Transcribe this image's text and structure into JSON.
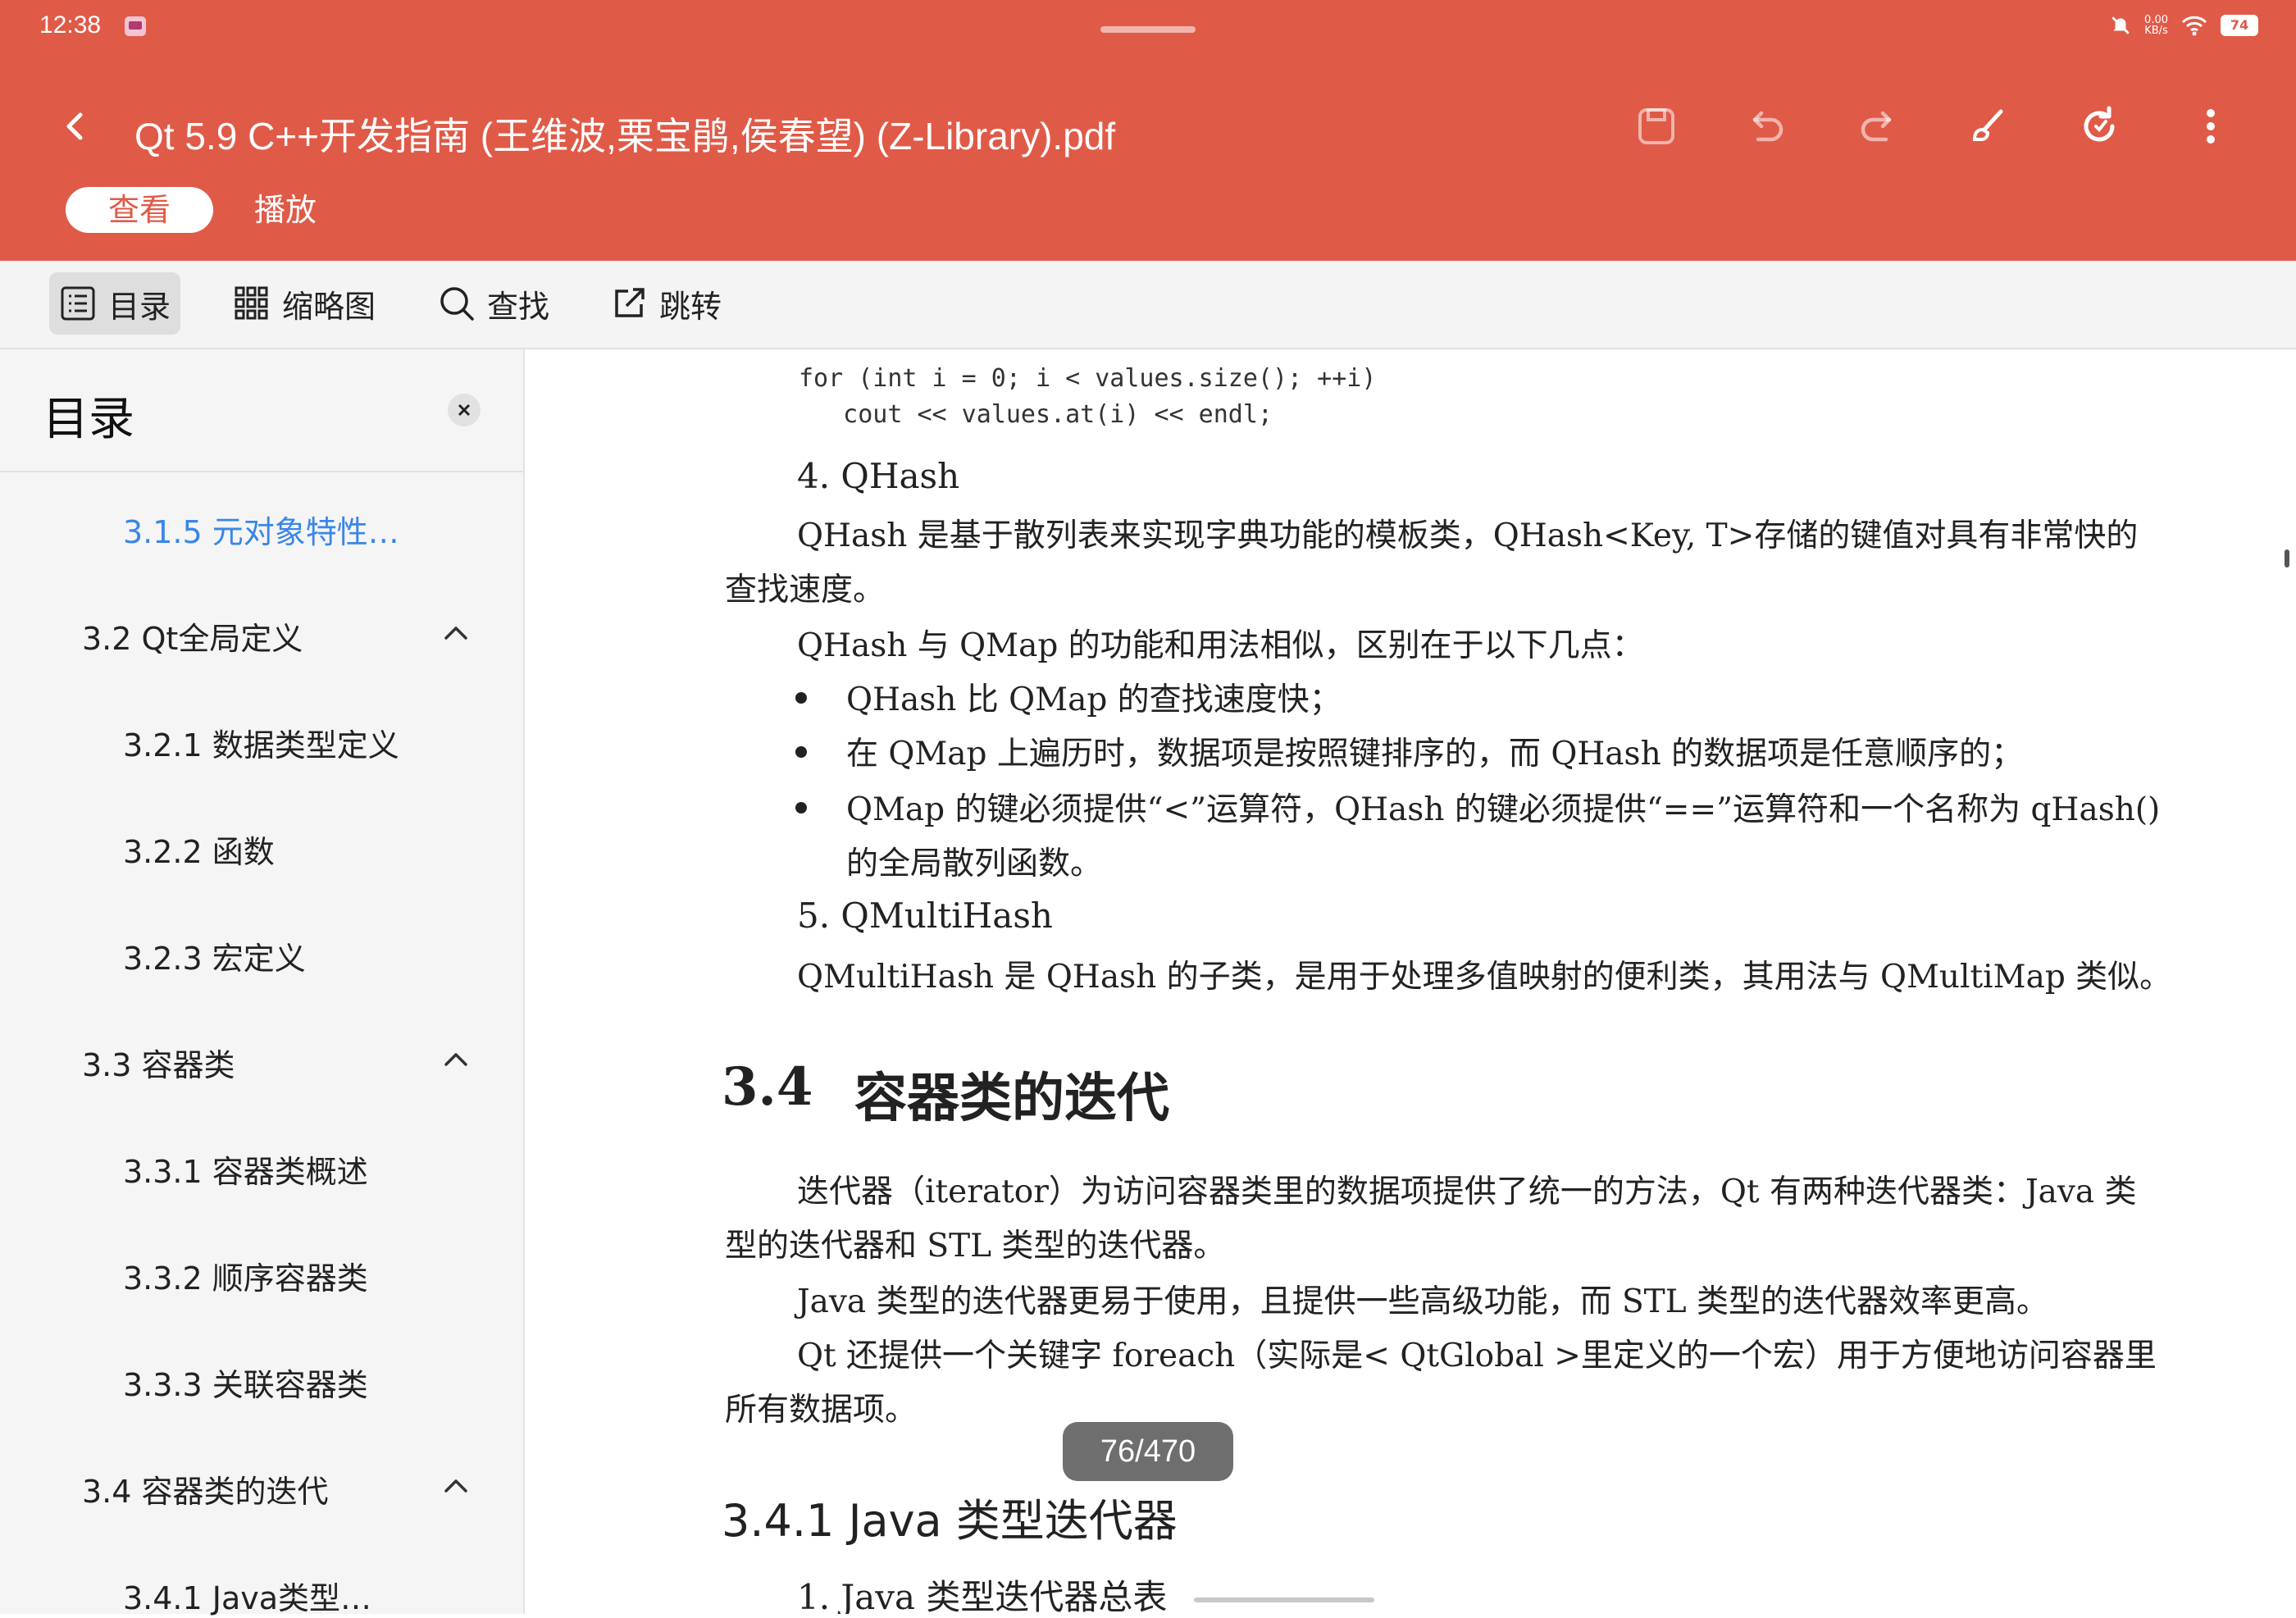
{
  "status_bar": {
    "time": "12:38",
    "net_speed_top": "0.00",
    "net_speed_bottom": "KB/s",
    "battery": "74"
  },
  "header": {
    "title": "Qt 5.9 C++开发指南 (王维波,栗宝鹃,侯春望) (Z-Library).pdf",
    "tabs": [
      {
        "label": "查看",
        "active": true
      },
      {
        "label": "播放",
        "active": false
      }
    ],
    "icons": [
      "back-icon",
      "save-icon",
      "undo-icon",
      "redo-icon",
      "brush-icon",
      "refresh-icon",
      "more-icon"
    ]
  },
  "toolbar": {
    "toc_label": "目录",
    "thumbnails_label": "缩略图",
    "search_label": "查找",
    "jump_label": "跳转"
  },
  "sidebar": {
    "title": "目录",
    "items": [
      {
        "label": "3.1.5 元对象特性…",
        "level": 2,
        "current": true
      },
      {
        "label": "3.2 Qt全局定义",
        "level": 1,
        "expandable": true
      },
      {
        "label": "3.2.1 数据类型定义",
        "level": 2
      },
      {
        "label": "3.2.2 函数",
        "level": 2
      },
      {
        "label": "3.2.3 宏定义",
        "level": 2
      },
      {
        "label": "3.3 容器类",
        "level": 1,
        "expandable": true
      },
      {
        "label": "3.3.1 容器类概述",
        "level": 2
      },
      {
        "label": "3.3.2 顺序容器类",
        "level": 2
      },
      {
        "label": "3.3.3 关联容器类",
        "level": 2
      },
      {
        "label": "3.4 容器类的迭代",
        "level": 1,
        "expandable": true
      },
      {
        "label": "3.4.1 Java类型…",
        "level": 2
      }
    ]
  },
  "document": {
    "code_line_1": "for (int i = 0; i < values.size(); ++i)",
    "code_line_2": "   cout << values.at(i) << endl;",
    "item4_heading": "4.  QHash",
    "para_qhash_1": "QHash 是基于散列表来实现字典功能的模板类，QHash<Key, T>存储的键值对具有非常快的",
    "para_qhash_2": "查找速度。",
    "para_diff": "QHash 与 QMap 的功能和用法相似，区别在于以下几点：",
    "bullet_1": "QHash 比 QMap 的查找速度快；",
    "bullet_2": "在 QMap 上遍历时，数据项是按照键排序的，而 QHash 的数据项是任意顺序的；",
    "bullet_3_line1": "QMap 的键必须提供“<”运算符，QHash 的键必须提供“==”运算符和一个名称为 qHash()",
    "bullet_3_line2": "的全局散列函数。",
    "item5_heading": "5.  QMultiHash",
    "para_multihash": "QMultiHash 是 QHash 的子类，是用于处理多值映射的便利类，其用法与 QMultiMap 类似。",
    "section_number": "3.4",
    "section_title": "容器类的迭代",
    "para_iter_1": "迭代器（iterator）为访问容器类里的数据项提供了统一的方法，Qt 有两种迭代器类：Java 类",
    "para_iter_2": "型的迭代器和 STL 类型的迭代器。",
    "para_java": "Java 类型的迭代器更易于使用，且提供一些高级功能，而 STL 类型的迭代器效率更高。",
    "para_foreach_1": "Qt 还提供一个关键字 foreach（实际是< QtGlobal >里定义的一个宏）用于方便地访问容器里",
    "para_foreach_2": "所有数据项。",
    "subsection": "3.4.1   Java 类型迭代器",
    "item1_heading": "1.  Java 类型迭代器总表"
  },
  "page_indicator": "76/470"
}
